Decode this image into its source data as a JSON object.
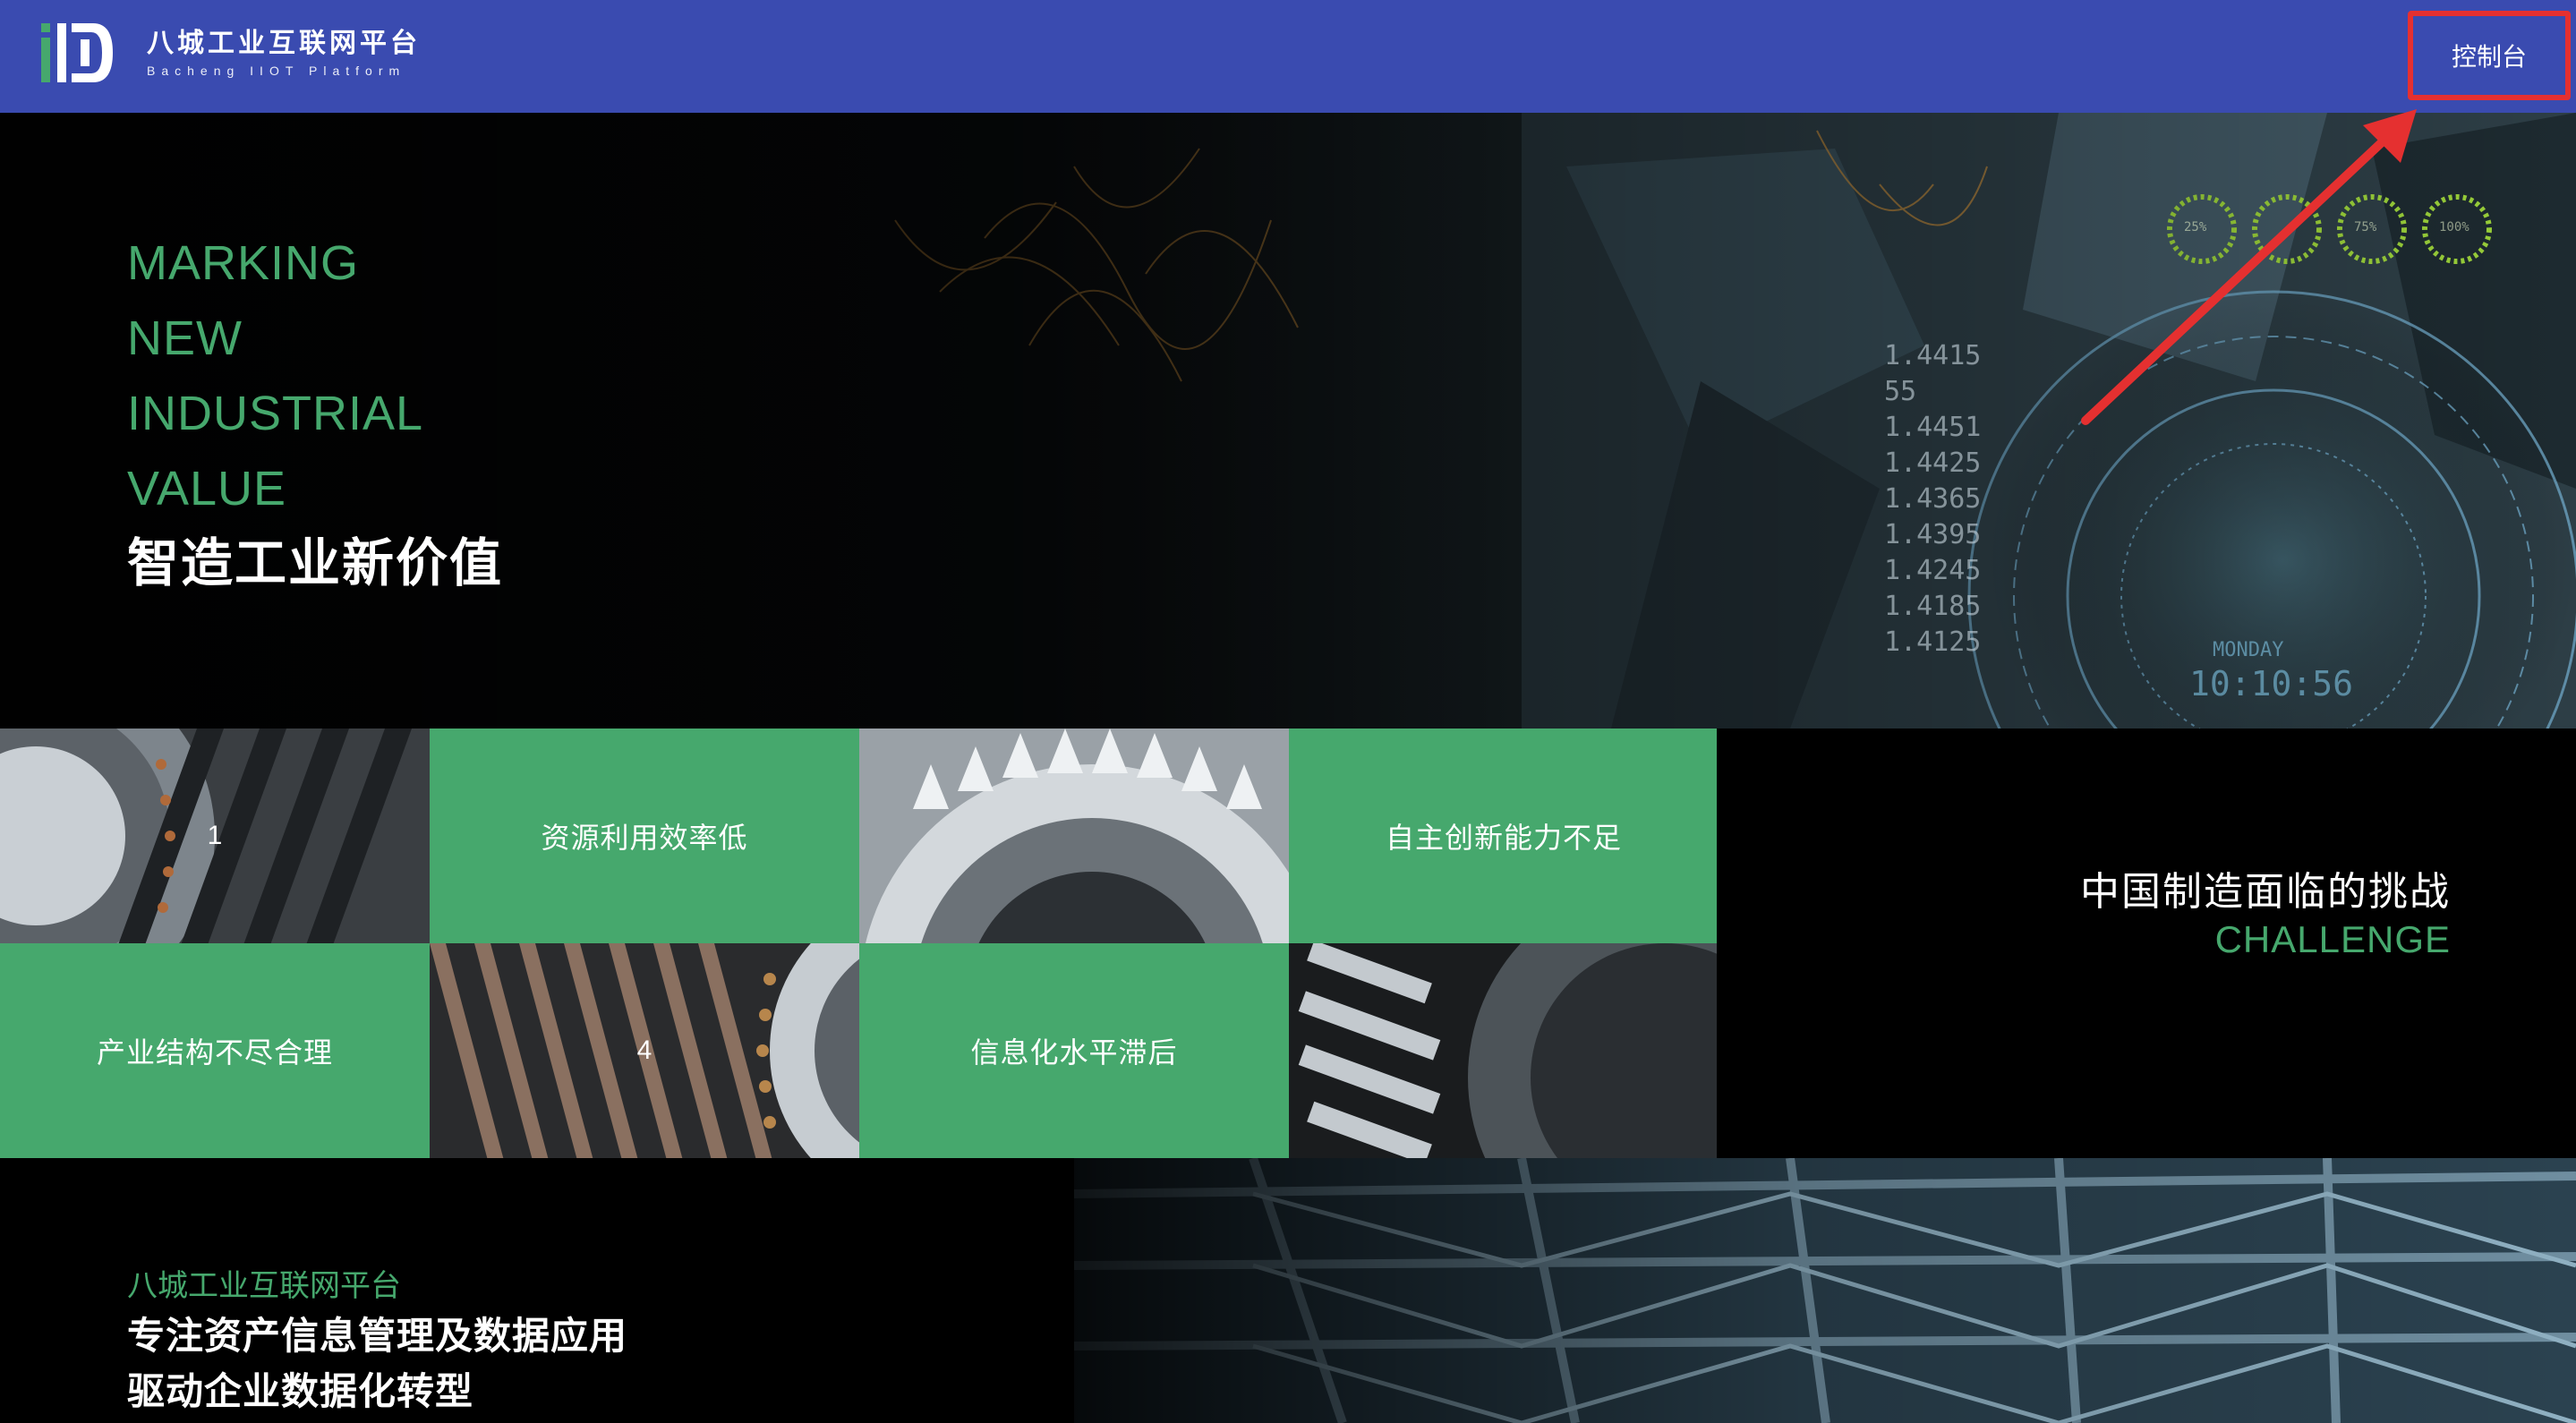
{
  "header": {
    "brand_cn": "八城工业互联网平台",
    "brand_en": "Bacheng IIOT Platform",
    "console_label": "控制台"
  },
  "hero": {
    "lines": [
      "MARKING",
      "NEW",
      "INDUSTRIAL",
      "VALUE"
    ],
    "title_cn": "智造工业新价值",
    "hud_percents": [
      "25%",
      "75%",
      "100%"
    ],
    "hud_numbers": [
      "1.4415",
      "55",
      "1.4451",
      "1.4425",
      "1.4365",
      "1.4395",
      "1.4245",
      "1.4185",
      "1.4125"
    ],
    "hud_clock": "10:10:56",
    "hud_day": "MONDAY"
  },
  "challenges": {
    "cells": [
      {
        "type": "image",
        "text": "1"
      },
      {
        "type": "text",
        "text": "资源利用效率低"
      },
      {
        "type": "image",
        "text": ""
      },
      {
        "type": "text",
        "text": "自主创新能力不足"
      },
      {
        "type": "text",
        "text": "产业结构不尽合理"
      },
      {
        "type": "image",
        "text": "4"
      },
      {
        "type": "text",
        "text": "信息化水平滞后"
      },
      {
        "type": "image",
        "text": ""
      }
    ],
    "title_cn": "中国制造面临的挑战",
    "title_en": "CHALLENGE"
  },
  "bottom": {
    "brand": "八城工业互联网平台",
    "line1": "专注资产信息管理及数据应用",
    "line2": "驱动企业数据化转型"
  },
  "colors": {
    "header_bg": "#3a4bb0",
    "accent_green": "#46a86d",
    "highlight_red": "#e53030"
  }
}
